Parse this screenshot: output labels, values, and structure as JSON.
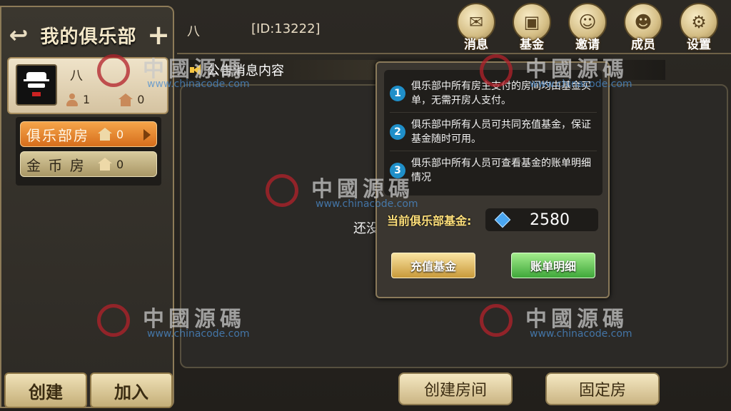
{
  "left_panel": {
    "title": "我的俱乐部",
    "club": {
      "name": "八",
      "member_count": "1",
      "room_count": "0"
    },
    "rooms": [
      {
        "label": "俱乐部房",
        "count": "0"
      },
      {
        "label": "金 币 房",
        "count": "0"
      }
    ],
    "create_label": "创建",
    "join_label": "加入"
  },
  "top": {
    "club_name": "八",
    "club_id": "[ID:13222]",
    "icons": [
      {
        "label": "消息",
        "icon": "message-icon"
      },
      {
        "label": "基金",
        "icon": "fund-icon"
      },
      {
        "label": "邀请",
        "icon": "invite-icon"
      },
      {
        "label": "成员",
        "icon": "members-icon"
      },
      {
        "label": "设置",
        "icon": "gear-icon"
      }
    ]
  },
  "notice": {
    "text": "公告消息内容"
  },
  "main": {
    "empty_text": "还没"
  },
  "fund_popup": {
    "tips": [
      {
        "num": "1",
        "text": "俱乐部中所有房主支付的房间均由基金买单，无需开房人支付。"
      },
      {
        "num": "2",
        "text": "俱乐部中所有人员可共同充值基金，保证基金随时可用。"
      },
      {
        "num": "3",
        "text": "俱乐部中所有人员可查看基金的账单明细情况"
      }
    ],
    "fund_label": "当前俱乐部基金:",
    "fund_value": "2580",
    "recharge_label": "充值基金",
    "bill_label": "账单明细"
  },
  "bottom_actions": {
    "create_room_label": "创建房间",
    "fixed_room_label": "固定房"
  },
  "watermark": {
    "text": "中國源碼",
    "url": "www.chinacode.com"
  }
}
